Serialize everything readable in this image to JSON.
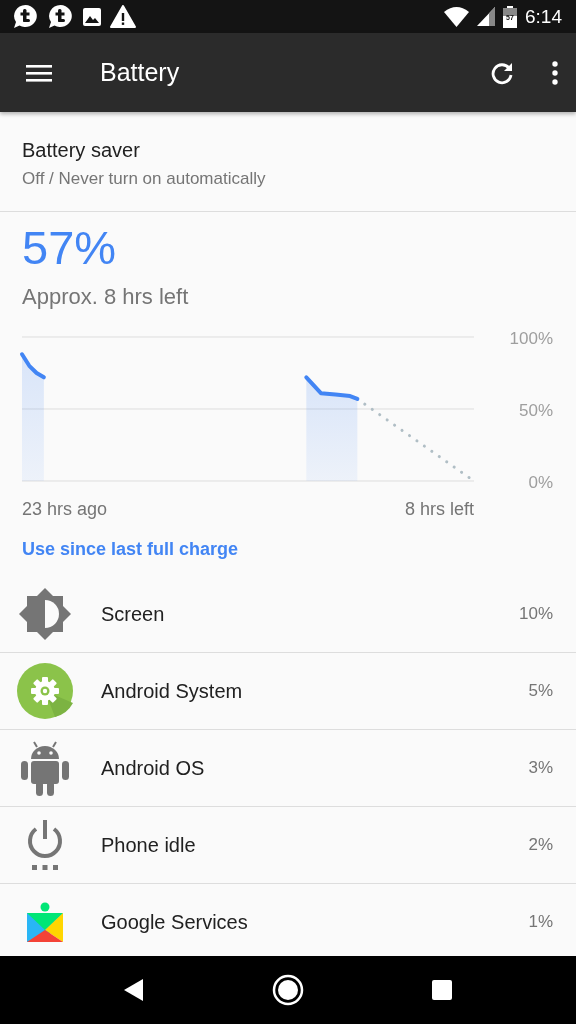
{
  "status_bar": {
    "time": "6:14",
    "battery_text": "57"
  },
  "app_bar": {
    "title": "Battery"
  },
  "battery_saver": {
    "title": "Battery saver",
    "subtitle": "Off / Never turn on automatically"
  },
  "summary": {
    "percent": "57%",
    "estimate": "Approx. 8 hrs left"
  },
  "history": {
    "scale_labels": [
      "100%",
      "50%",
      "0%"
    ],
    "start_label": "23 hrs ago",
    "end_label": "8 hrs left"
  },
  "usage_link": "Use since last full charge",
  "usage": [
    {
      "kind": "screen",
      "name": "Screen",
      "percent": "10%"
    },
    {
      "kind": "system",
      "name": "Android System",
      "percent": "5%"
    },
    {
      "kind": "os",
      "name": "Android OS",
      "percent": "3%"
    },
    {
      "kind": "idle",
      "name": "Phone idle",
      "percent": "2%"
    },
    {
      "kind": "services",
      "name": "Google Services",
      "percent": "1%"
    }
  ]
}
